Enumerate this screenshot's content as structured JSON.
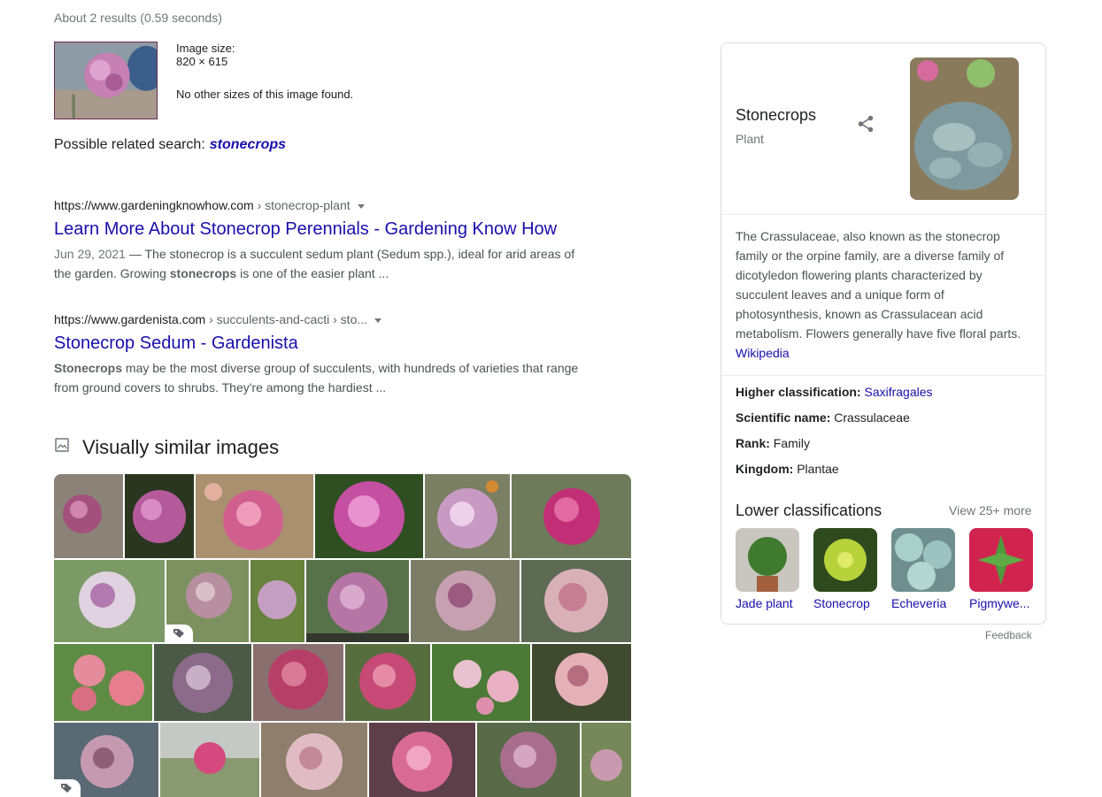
{
  "stats": "About 2 results (0.59 seconds)",
  "image_info": {
    "size_label": "Image size:",
    "size_value": "820 × 615",
    "no_other_sizes": "No other sizes of this image found."
  },
  "related_search": {
    "label": "Possible related search:",
    "query": "stonecrops"
  },
  "results": [
    {
      "domain": "https://www.gardeningknowhow.com",
      "path": " › stonecrop-plant",
      "title": "Learn More About Stonecrop Perennials - Gardening Know How",
      "date": "Jun 29, 2021",
      "snippet_a": " — The stonecrop is a succulent sedum plant (Sedum spp.), ideal for arid areas of the garden. Growing ",
      "snippet_bold": "stonecrops",
      "snippet_b": " is one of the easier plant ..."
    },
    {
      "domain": "https://www.gardenista.com",
      "path": " › succulents-and-cacti › sto...",
      "title": "Stonecrop Sedum - Gardenista",
      "snippet_bold": "Stonecrops",
      "snippet_b": " may be the most diverse group of succulents, with hundreds of varieties that range from ground covers to shrubs. They're among the hardiest ..."
    }
  ],
  "visually_similar": {
    "title": "Visually similar images",
    "icon": "image-icon"
  },
  "knowledge_panel": {
    "title": "Stonecrops",
    "subtitle": "Plant",
    "description": "The Crassulaceae, also known as the stonecrop family or the orpine family, are a diverse family of dicotyledon flowering plants characterized by succulent leaves and a unique form of photosynthesis, known as Crassulacean acid metabolism. Flowers generally have five floral parts.",
    "source": "Wikipedia",
    "facts": [
      {
        "label": "Higher classification:",
        "value": "Saxifragales",
        "link": true
      },
      {
        "label": "Scientific name:",
        "value": "Crassulaceae",
        "link": false
      },
      {
        "label": "Rank:",
        "value": "Family",
        "link": false
      },
      {
        "label": "Kingdom:",
        "value": "Plantae",
        "link": false
      }
    ],
    "lower_title": "Lower classifications",
    "view_more": "View 25+ more",
    "lower": [
      {
        "label": "Jade plant"
      },
      {
        "label": "Stonecrop"
      },
      {
        "label": "Echeveria"
      },
      {
        "label": "Pigmywe..."
      }
    ]
  },
  "feedback": "Feedback",
  "colors": {
    "link": "#1a0dab",
    "text": "#202124",
    "muted": "#70757a",
    "border": "#dadce0"
  }
}
